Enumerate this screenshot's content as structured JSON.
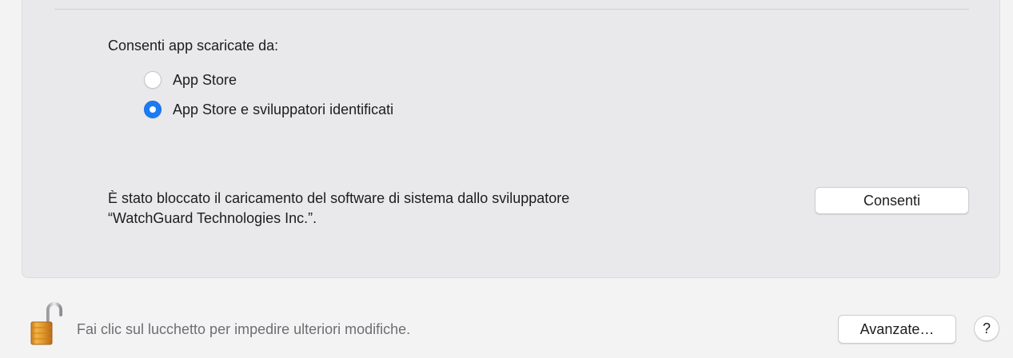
{
  "gatekeeper": {
    "allow_apps_label": "Consenti app scaricate da:",
    "options": [
      {
        "label": "App Store",
        "selected": false
      },
      {
        "label": "App Store e sviluppatori identificati",
        "selected": true
      }
    ]
  },
  "blocked": {
    "line1": "È stato bloccato il caricamento del software di sistema dallo sviluppatore",
    "line2": "“WatchGuard Technologies Inc.”.",
    "allow_button": "Consenti"
  },
  "footer": {
    "lock_icon": "unlocked-padlock-icon",
    "lock_text": "Fai clic sul lucchetto per impedire ulteriori modifiche.",
    "advanced_button": "Avanzate…",
    "help_button": "?"
  },
  "colors": {
    "accent": "#1a7cf5",
    "panel": "#e9e9eb",
    "window": "#f3f3f4",
    "lock_gold": "#e3a033"
  }
}
